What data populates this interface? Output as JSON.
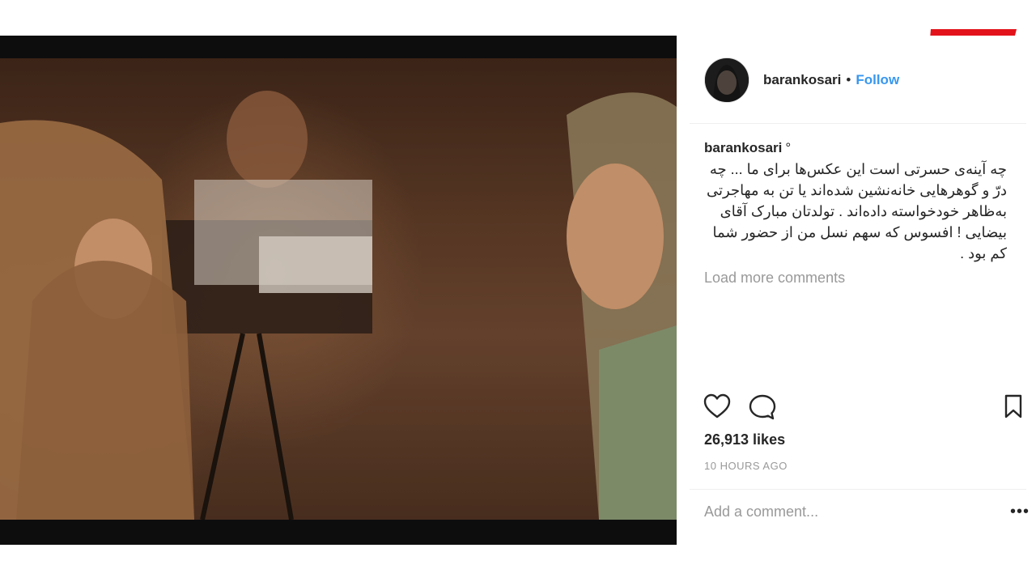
{
  "colors": {
    "follow_link": "#3897f0",
    "logo_red": "#e3131b",
    "muted_text": "#999999",
    "frame": "#0d0d0d"
  },
  "logo": {
    "alt_icon": "rokna-logo"
  },
  "post": {
    "username": "barankosari",
    "separator": "•",
    "follow_label": "Follow",
    "caption_username": "barankosari",
    "caption_mark": "°",
    "caption_text": "چه آینه‌ی حسرتی است این عکس‌ها برای ما ... چه درّ و گوهرهایی خانه‌نشین شده‌اند یا تن به مهاجرتی به‌ظاهر خودخواسته داده‌اند . تولدتان مبارک آقای بیضایی ! افسوس که سهم نسل من از حضور شما کم بود .",
    "load_more": "Load more comments",
    "likes": "26,913 likes",
    "time_ago": "10 HOURS AGO",
    "comment_placeholder": "Add a comment...",
    "more_options": "•••"
  },
  "icons": [
    "heart-icon",
    "comment-icon",
    "bookmark-icon"
  ]
}
